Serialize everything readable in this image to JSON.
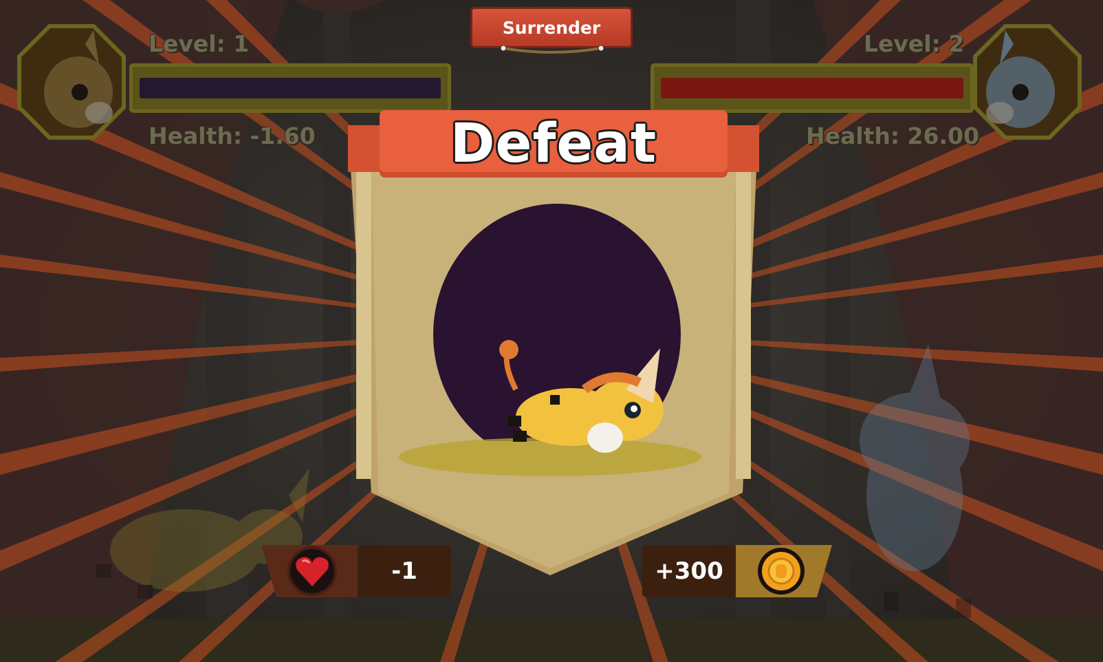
{
  "hud": {
    "player": {
      "level_label": "Level: 1",
      "health_label": "Health: -1.60",
      "health_bar_fraction": 0.0,
      "portrait_icon": "donkey-portrait-icon"
    },
    "opponent": {
      "level_label": "Level: 2",
      "health_label": "Health: 26.00",
      "health_bar_fraction": 1.0,
      "portrait_icon": "donkey-portrait-icon"
    },
    "surrender_label": "Surrender"
  },
  "result_panel": {
    "title": "Defeat",
    "character_icon": "knocked-out-donkey-icon"
  },
  "rewards": {
    "lives": {
      "icon": "heart-gem-icon",
      "value": "-1"
    },
    "coins": {
      "icon": "gold-coin-icon",
      "value": "+300"
    }
  },
  "colors": {
    "banner": "#e8603e",
    "panel": "#cdb57a",
    "badge_dark": "#3b2010",
    "ray": "#c8501e",
    "health_fill": "#7a1712"
  }
}
